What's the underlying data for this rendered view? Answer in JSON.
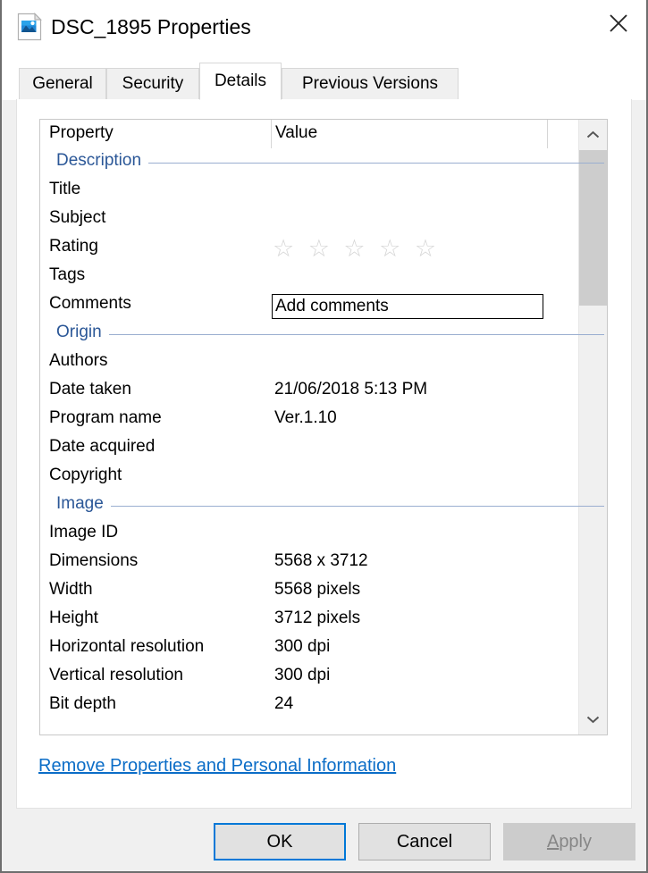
{
  "window": {
    "title": "DSC_1895 Properties",
    "icon": "image-file-icon",
    "close_label": "close-icon"
  },
  "tabs": [
    {
      "label": "General",
      "selected": false
    },
    {
      "label": "Security",
      "selected": false
    },
    {
      "label": "Details",
      "selected": true
    },
    {
      "label": "Previous Versions",
      "selected": false
    }
  ],
  "list": {
    "columns": {
      "property": "Property",
      "value": "Value"
    },
    "rows": [
      {
        "type": "section",
        "label": "Description",
        "value": ""
      },
      {
        "type": "item",
        "label": "Title",
        "value": ""
      },
      {
        "type": "item",
        "label": "Subject",
        "value": ""
      },
      {
        "type": "rating",
        "label": "Rating",
        "value": "",
        "stars": "☆ ☆ ☆ ☆ ☆",
        "star_count": 5,
        "filled": 0
      },
      {
        "type": "item",
        "label": "Tags",
        "value": ""
      },
      {
        "type": "comments",
        "label": "Comments",
        "value": "Add comments"
      },
      {
        "type": "section",
        "label": "Origin",
        "value": ""
      },
      {
        "type": "item",
        "label": "Authors",
        "value": ""
      },
      {
        "type": "item",
        "label": "Date taken",
        "value": "21/06/2018 5:13 PM"
      },
      {
        "type": "item",
        "label": "Program name",
        "value": "Ver.1.10"
      },
      {
        "type": "item",
        "label": "Date acquired",
        "value": ""
      },
      {
        "type": "item",
        "label": "Copyright",
        "value": ""
      },
      {
        "type": "section",
        "label": "Image",
        "value": ""
      },
      {
        "type": "item",
        "label": "Image ID",
        "value": ""
      },
      {
        "type": "item",
        "label": "Dimensions",
        "value": "5568 x 3712"
      },
      {
        "type": "item",
        "label": "Width",
        "value": "5568 pixels"
      },
      {
        "type": "item",
        "label": "Height",
        "value": "3712 pixels"
      },
      {
        "type": "item",
        "label": "Horizontal resolution",
        "value": "300 dpi"
      },
      {
        "type": "item",
        "label": "Vertical resolution",
        "value": "300 dpi"
      },
      {
        "type": "item",
        "label": "Bit depth",
        "value": "24"
      }
    ],
    "scrollbar": {
      "up_icon": "chevron-up-icon",
      "down_icon": "chevron-down-icon",
      "thumb_top_pct": 0,
      "thumb_size_pct": 28
    }
  },
  "remove_link": "Remove Properties and Personal Information",
  "buttons": {
    "ok": "OK",
    "cancel": "Cancel",
    "apply_prefix": "A",
    "apply_rest": "pply",
    "apply_disabled": true
  },
  "colors": {
    "accent": "#0078d7",
    "link": "#0b6dc7",
    "section_header": "#2b5797",
    "section_rule": "#9aaed0",
    "dialog_bg": "#f0f0f0",
    "panel_bg": "#ffffff",
    "star": "#d5d5d5",
    "scroll_thumb": "#cdcdcd"
  }
}
